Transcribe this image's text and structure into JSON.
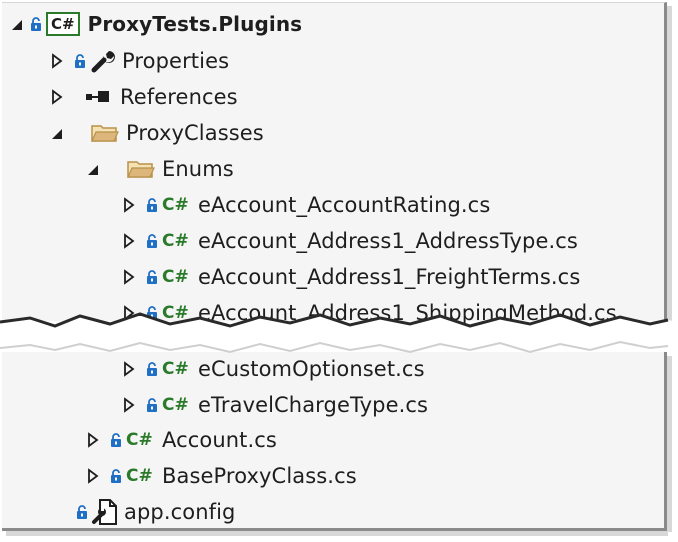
{
  "tree": {
    "project": "ProxyTests.Plugins",
    "project_badge": "C#",
    "items": [
      {
        "label": "Properties",
        "icon": "wrench-icon"
      },
      {
        "label": "References",
        "icon": "references-icon"
      },
      {
        "label": "ProxyClasses",
        "icon": "folder-open-icon"
      },
      {
        "label": "Enums",
        "icon": "folder-open-icon"
      },
      {
        "label": "eAccount_AccountRating.cs",
        "icon": "csharp-file-icon"
      },
      {
        "label": "eAccount_Address1_AddressType.cs",
        "icon": "csharp-file-icon"
      },
      {
        "label": "eAccount_Address1_FreightTerms.cs",
        "icon": "csharp-file-icon"
      },
      {
        "label": "eAccount_Address1_ShippingMethod.cs",
        "icon": "csharp-file-icon"
      },
      {
        "label": "eCustomOptionset.cs",
        "icon": "csharp-file-icon"
      },
      {
        "label": "eTravelChargeType.cs",
        "icon": "csharp-file-icon"
      },
      {
        "label": "Account.cs",
        "icon": "csharp-file-icon"
      },
      {
        "label": "BaseProxyClass.cs",
        "icon": "csharp-file-icon"
      },
      {
        "label": "app.config",
        "icon": "config-file-icon"
      }
    ],
    "cs_badge": "C#"
  },
  "colors": {
    "background": "#f5f5f5",
    "text": "#1e1e1e",
    "csharp_green": "#2a7a2a",
    "lock_blue": "#1f6fc5",
    "folder": "#dcb67a"
  }
}
